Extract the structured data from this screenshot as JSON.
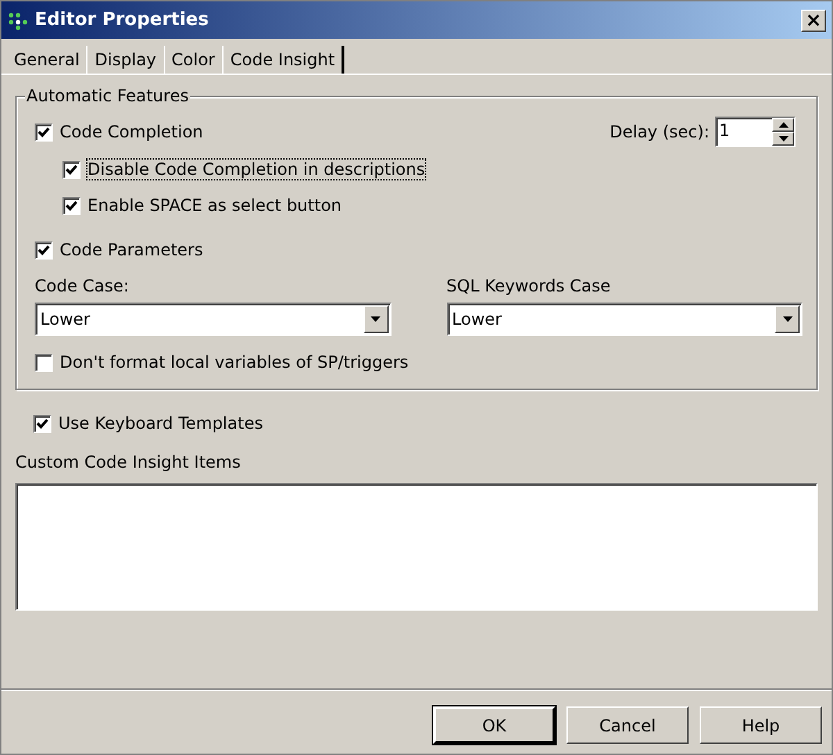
{
  "window": {
    "title": "Editor Properties",
    "close": "×"
  },
  "tabs": [
    {
      "label": "General",
      "selected": false
    },
    {
      "label": "Display",
      "selected": false
    },
    {
      "label": "Color",
      "selected": false
    },
    {
      "label": "Code Insight",
      "selected": true
    }
  ],
  "group": {
    "title": "Automatic Features",
    "code_completion": {
      "label": "Code Completion",
      "checked": true,
      "focused": false
    },
    "delay": {
      "label": "Delay (sec):",
      "value": "1"
    },
    "sub_options": [
      {
        "label": "Disable Code Completion in descriptions",
        "checked": true,
        "focused": true
      },
      {
        "label": "Enable SPACE as select button",
        "checked": true,
        "focused": false
      }
    ],
    "code_parameters": {
      "label": "Code Parameters",
      "checked": true,
      "focused": false
    },
    "case_fields": [
      {
        "label": "Code Case:",
        "value": "Lower"
      },
      {
        "label": "SQL Keywords Case",
        "value": "Lower"
      }
    ],
    "dont_format": {
      "label": "Don't format local variables of SP/triggers",
      "checked": false,
      "focused": false
    }
  },
  "use_keyboard_templates": {
    "label": "Use Keyboard Templates",
    "checked": true,
    "focused": false
  },
  "custom_items": {
    "label": "Custom Code Insight Items"
  },
  "buttons": [
    {
      "label": "OK",
      "default": true
    },
    {
      "label": "Cancel",
      "default": false
    },
    {
      "label": "Help",
      "default": false
    }
  ]
}
